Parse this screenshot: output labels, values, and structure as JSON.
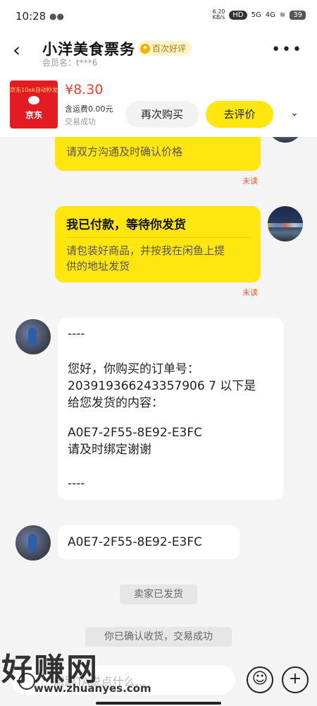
{
  "status": {
    "time": "10:28",
    "speed": "6.20 KB/s",
    "hd": "HD",
    "g5": "5G",
    "g4": "4G",
    "battery": "39"
  },
  "header": {
    "title": "小洋美食票务",
    "badge": "百次好评",
    "member": "会员名：t***6"
  },
  "order": {
    "thumb_top": "京东10ek自动秒发",
    "thumb_brand": "京东",
    "price": "¥8.30",
    "shipping": "含运费0.00元",
    "status": "交易成功",
    "rebuy_label": "再次购买",
    "review_label": "去评价"
  },
  "chat": {
    "msg1_text": "请双方沟通及时确认价格",
    "unread1": "未读",
    "msg2_title": "我已付款，等待你发货",
    "msg2_body_1": "请包装好商品，并按我在闲鱼上提",
    "msg2_body_2": "供的地址发货",
    "unread2": "未读",
    "seller_lines": [
      "----",
      "",
      "您好，你购买的订单号：",
      "203919366243357906 7 以下是",
      "给您发货的内容：",
      "",
      "A0E7-2F55-8E92-E3FC",
      "请及时绑定谢谢",
      "",
      "----"
    ],
    "seller_l1": "----",
    "seller_l2": "您好，你购买的订单号：",
    "seller_l3": "203919366243357906 7 以下是",
    "seller_l4": "给您发货的内容：",
    "seller_l5": "A0E7-2F55-8E92-E3FC",
    "seller_l6": "请及时绑定谢谢",
    "seller_l7": "----",
    "code_msg": "A0E7-2F55-8E92-E3FC",
    "sys1": "卖家已发货",
    "sys2": "你已确认收货，交易成功"
  },
  "input": {
    "placeholder": "想跟TA说点什么..."
  },
  "watermark": {
    "big": "好赚网",
    "small": "www.zhuanyes.com"
  }
}
